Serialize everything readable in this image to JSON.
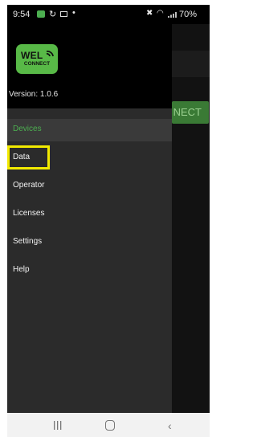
{
  "status_bar": {
    "time": "9:54",
    "battery": "70%",
    "icons": [
      "notification-icon",
      "sync-icon",
      "image-icon",
      "dot-icon",
      "mute-icon",
      "wifi-icon",
      "signal-icon",
      "battery-icon"
    ]
  },
  "drawer": {
    "logo": {
      "line1": "WEL",
      "line2": "CONNECT"
    },
    "version": "Version: 1.0.6",
    "items": [
      {
        "label": "Devices",
        "selected": true
      },
      {
        "label": "Data",
        "selected": false
      },
      {
        "label": "Operator",
        "selected": false
      },
      {
        "label": "Licenses",
        "selected": false
      },
      {
        "label": "Settings",
        "selected": false
      },
      {
        "label": "Help",
        "selected": false
      }
    ]
  },
  "background_app": {
    "connect_button_label": "NECT"
  },
  "colors": {
    "accent": "#4caf50",
    "drawer_bg": "#2b2b2b",
    "highlight": "#f2ea00"
  },
  "nav_bar": {
    "icons": [
      "recent-apps-icon",
      "home-icon",
      "back-icon"
    ]
  }
}
